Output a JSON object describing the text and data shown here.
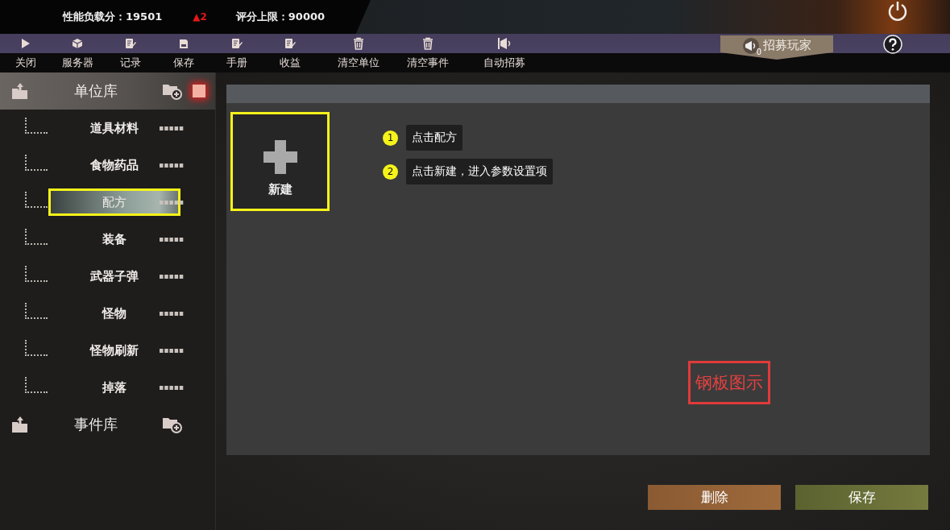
{
  "top_bar": {
    "stats": [
      {
        "label": "性能负载分：19501"
      },
      {
        "label": "▲2",
        "kind": "alert"
      },
      {
        "label": "评分上限：90000"
      }
    ]
  },
  "toolbar": [
    {
      "label": "关闭",
      "kind": "play"
    },
    {
      "label": "服务器",
      "kind": "cube"
    },
    {
      "label": "记录",
      "kind": "edit"
    },
    {
      "label": "保存",
      "kind": "save"
    },
    {
      "label": "手册",
      "kind": "edit"
    },
    {
      "label": "收益",
      "kind": "edit"
    },
    {
      "label": "清空单位",
      "kind": "trash"
    },
    {
      "label": "清空事件",
      "kind": "trash"
    },
    {
      "label": "自动招募",
      "kind": "flag"
    }
  ],
  "recruit_button": {
    "label": "招募玩家",
    "count": "0"
  },
  "sidebar": {
    "groups": [
      {
        "title": "单位库",
        "expanded": true,
        "items": [
          {
            "label": "道具材料",
            "selected": false
          },
          {
            "label": "食物药品",
            "selected": false
          },
          {
            "label": "配方",
            "selected": true
          },
          {
            "label": "装备",
            "selected": false
          },
          {
            "label": "武器子弹",
            "selected": false
          },
          {
            "label": "怪物",
            "selected": false
          },
          {
            "label": "怪物刷新",
            "selected": false
          },
          {
            "label": "掉落",
            "selected": false
          }
        ]
      },
      {
        "title": "事件库",
        "expanded": false
      }
    ]
  },
  "panel": {
    "new_tile": {
      "label": "新建",
      "highlighted": true
    },
    "callouts": [
      {
        "number": "1",
        "text": "点击配方"
      },
      {
        "number": "2",
        "text": "点击新建，进入参数设置项"
      }
    ],
    "note": "钢板图示"
  },
  "buttons": [
    {
      "label": "删除",
      "kind": "danger"
    },
    {
      "label": "保存",
      "kind": "confirm"
    }
  ]
}
